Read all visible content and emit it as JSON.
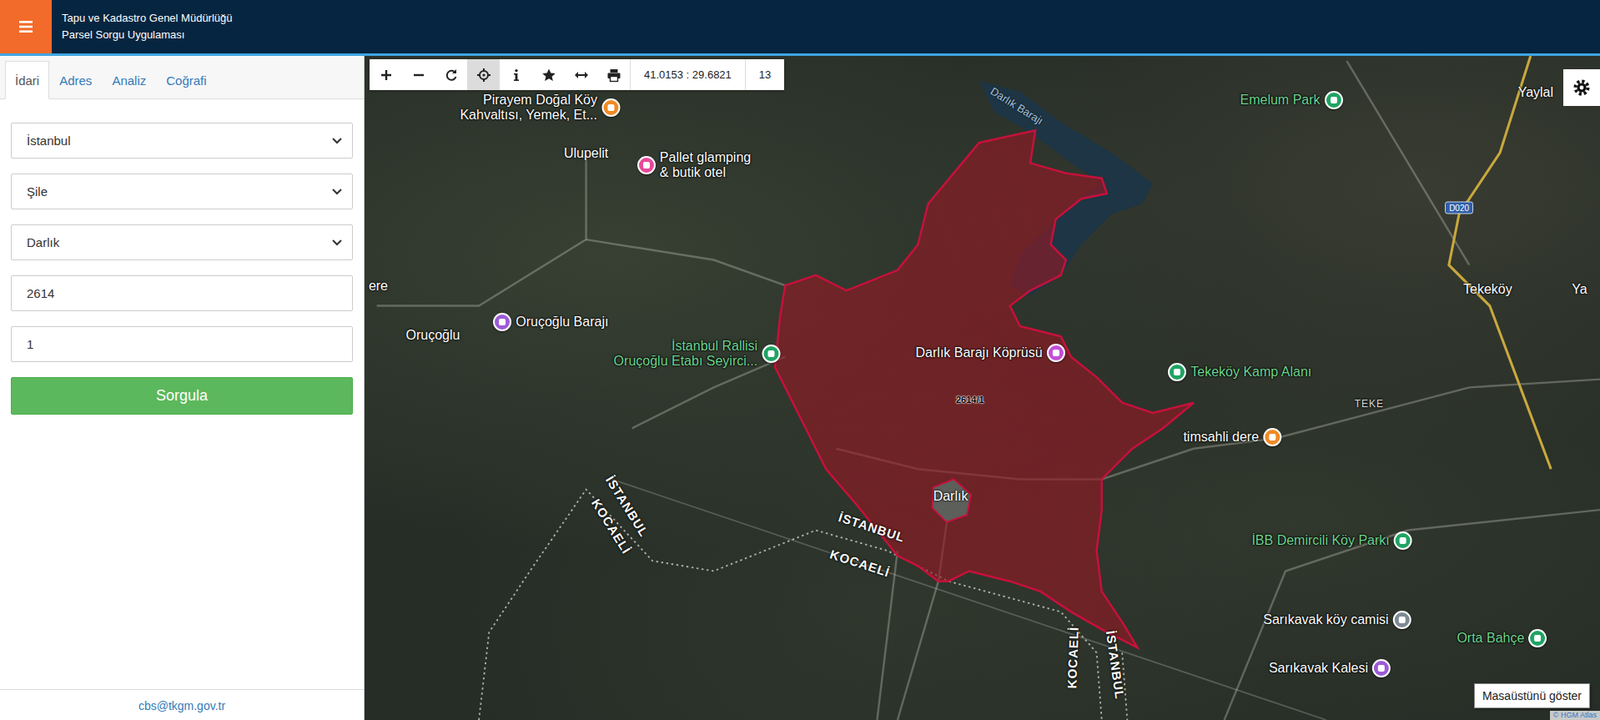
{
  "header": {
    "title": "Tapu ve Kadastro Genel Müdürlüğü",
    "subtitle": "Parsel Sorgu Uygulaması"
  },
  "tabs": [
    {
      "label": "İdari",
      "selected": true
    },
    {
      "label": "Adres",
      "selected": false
    },
    {
      "label": "Analiz",
      "selected": false
    },
    {
      "label": "Coğrafi",
      "selected": false
    }
  ],
  "form": {
    "fields": [
      {
        "kind": "select",
        "value": "İstanbul"
      },
      {
        "kind": "select",
        "value": "Şile"
      },
      {
        "kind": "select",
        "value": "Darlık"
      },
      {
        "kind": "input",
        "value": "2614"
      },
      {
        "kind": "input",
        "value": "1"
      }
    ],
    "submit": "Sorgula"
  },
  "footer": {
    "email": "cbs@tkgm.gov.tr"
  },
  "toolbar": {
    "tools": [
      {
        "kind": "zoom-in",
        "selected": false
      },
      {
        "kind": "zoom-out",
        "selected": false
      },
      {
        "kind": "refresh",
        "selected": false
      },
      {
        "kind": "locate",
        "selected": true
      },
      {
        "kind": "info",
        "selected": false
      },
      {
        "kind": "favorite",
        "selected": false
      },
      {
        "kind": "measure",
        "selected": false
      },
      {
        "kind": "print",
        "selected": false
      }
    ],
    "coordinates": "41.0153 : 29.6821",
    "zoom": "13"
  },
  "map": {
    "parcel_label": "2614/1",
    "labels": [
      {
        "kind": "poi",
        "lines": [
          "Pirayem Doğal Köy",
          "Kahvaltısı, Yemek, Et..."
        ],
        "color": "#f08a24",
        "text_color": "#ffffff"
      },
      {
        "kind": "place",
        "text": "Ulupelit"
      },
      {
        "kind": "poi",
        "lines": [
          "Pallet glamping",
          "& butik otel"
        ],
        "color": "#e8489a",
        "text_color": "#ffffff"
      },
      {
        "kind": "place",
        "text": "Oruçoğlu"
      },
      {
        "kind": "poi",
        "lines": [
          "Oruçoğlu Barajı"
        ],
        "color": "#9c5bd6",
        "text_color": "#ffffff"
      },
      {
        "kind": "poi",
        "lines": [
          "İstanbul Rallisi",
          "Oruçoğlu Etabı Seyirci..."
        ],
        "color": "#1fa463",
        "text_color": "#6fd690"
      },
      {
        "kind": "poi",
        "lines": [
          "Darlık Barajı Köprüsü"
        ],
        "color": "#c34fd8",
        "text_color": "#ffffff"
      },
      {
        "kind": "poi",
        "lines": [
          "Emelum Park"
        ],
        "color": "#1fa463",
        "text_color": "#6fd690"
      },
      {
        "kind": "place",
        "text": "Tekeköy"
      },
      {
        "kind": "poi",
        "lines": [
          "Tekeköy Kamp Alanı"
        ],
        "color": "#1fa463",
        "text_color": "#6fd690"
      },
      {
        "kind": "small-place",
        "text": "TEKE"
      },
      {
        "kind": "poi",
        "lines": [
          "timsahli dere"
        ],
        "color": "#f08a24",
        "text_color": "#ffffff"
      },
      {
        "kind": "poi",
        "lines": [
          "İBB Demircili Köy Parkı"
        ],
        "color": "#1fa463",
        "text_color": "#6fd690"
      },
      {
        "kind": "poi",
        "lines": [
          "Sarıkavak köy camisi"
        ],
        "color": "#7d8a93",
        "text_color": "#ffffff"
      },
      {
        "kind": "poi",
        "lines": [
          "Orta Bahçe"
        ],
        "color": "#1fa463",
        "text_color": "#6fd690"
      },
      {
        "kind": "poi",
        "lines": [
          "Sarıkavak Kalesi"
        ],
        "color": "#9c5bd6",
        "text_color": "#ffffff"
      },
      {
        "kind": "place",
        "text": "Darlık"
      },
      {
        "kind": "region",
        "text": "İSTANBUL"
      },
      {
        "kind": "region",
        "text": "KOCAELİ"
      },
      {
        "kind": "region",
        "text": "İSTANBUL"
      },
      {
        "kind": "region",
        "text": "KOCAELİ"
      },
      {
        "kind": "region",
        "text": "KOCAELİ"
      },
      {
        "kind": "region",
        "text": "İSTANBUL"
      },
      {
        "kind": "water",
        "text": "Darlık Barajı"
      },
      {
        "kind": "shield",
        "text": "D020"
      },
      {
        "kind": "place",
        "text": "Yaylal"
      },
      {
        "kind": "place",
        "text": "Ya"
      },
      {
        "kind": "place",
        "text": "ere"
      }
    ],
    "attribution": "© HGM Atlas"
  },
  "tooltip": "Masaüstünü göster"
}
